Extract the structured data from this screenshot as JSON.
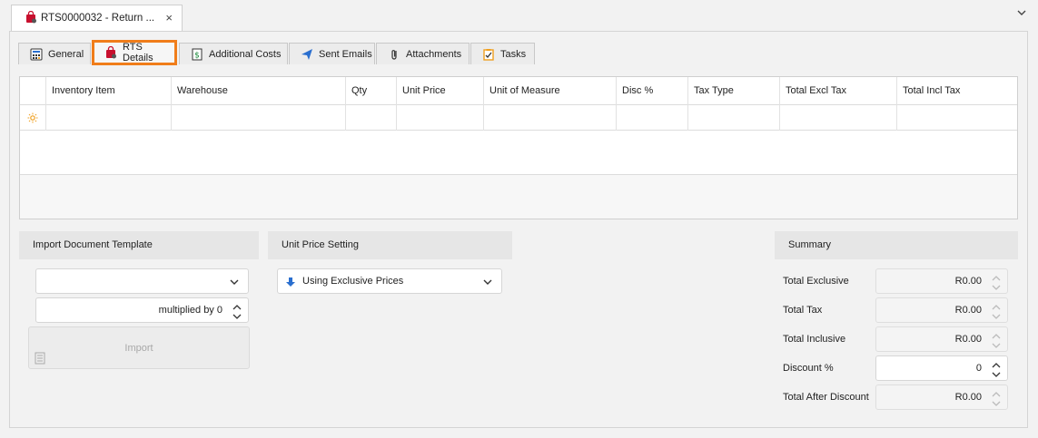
{
  "document_tab": {
    "title": "RTS0000032 - Return ...",
    "close": "×"
  },
  "tabs": [
    {
      "label": "General"
    },
    {
      "label": "RTS Details"
    },
    {
      "label": "Additional Costs"
    },
    {
      "label": "Sent Emails"
    },
    {
      "label": "Attachments"
    },
    {
      "label": "Tasks"
    }
  ],
  "grid": {
    "columns": [
      "Inventory Item",
      "Warehouse",
      "Qty",
      "Unit Price",
      "Unit of Measure",
      "Disc %",
      "Tax Type",
      "Total Excl Tax",
      "Total Incl Tax"
    ]
  },
  "import_section": {
    "header": "Import Document Template",
    "template_value": "",
    "multiplier_text": "multiplied by 0",
    "import_button": "Import"
  },
  "price_section": {
    "header": "Unit Price Setting",
    "value": "Using Exclusive Prices"
  },
  "summary": {
    "header": "Summary",
    "rows": [
      {
        "label": "Total Exclusive",
        "value": "R0.00"
      },
      {
        "label": "Total Tax",
        "value": "R0.00"
      },
      {
        "label": "Total Inclusive",
        "value": "R0.00"
      },
      {
        "label": "Discount %",
        "value": "0"
      },
      {
        "label": "Total After Discount",
        "value": "R0.00"
      }
    ]
  },
  "colors": {
    "active_tab_border": "#f07d1a",
    "new_row_icon": "#f0a020"
  }
}
